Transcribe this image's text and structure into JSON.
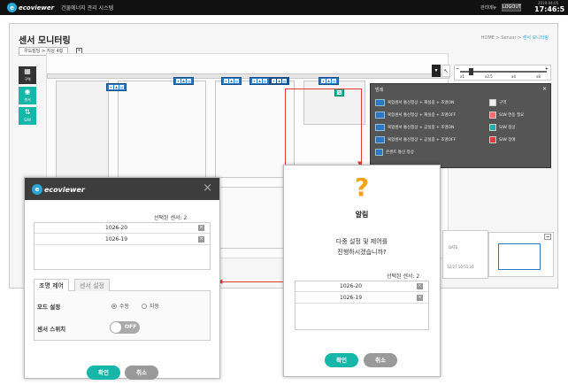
{
  "topbar": {
    "logo_mark": "e",
    "logo_text": "ecoviewer",
    "system_name": "건물에너지 관리 시스템",
    "manage_label": "관리메뉴",
    "logout_label": "LOGOUT",
    "date": "2019-04-05",
    "time": "17:46:5"
  },
  "page": {
    "title": "센서 모니터링",
    "breadcrumb_home": "HOME > Sensor > ",
    "breadcrumb_current": "센서 모니터링",
    "location_tab": "우도빌딩 > 지상 4층",
    "location_icon": "+"
  },
  "side": {
    "zone_icon": "▦",
    "zone_label": "구역",
    "sensor_icon": "◉",
    "sensor_label": "센서",
    "sw_icon": "⇅",
    "sw_label": "S/W"
  },
  "tools": {
    "arrow": "▾",
    "pointer": "↖",
    "zoom_out": "−",
    "zoom_in": "+",
    "zoom_levels": [
      "x1",
      "x2.5",
      "x4",
      "x8"
    ]
  },
  "legend": {
    "title": "범례",
    "close": "×",
    "rows": [
      "복합센서 통신정상 + 재실중 + 조명ON",
      "복합센서 통신정상 + 재실중 + 조명OFF",
      "복합센서 통신정상 + 공실중 + 조명ON",
      "복합센서 통신정상 + 공실중 + 조명OFF",
      "콘센트 통신 정상"
    ],
    "right": [
      {
        "label": "구역",
        "color": "#eeeeee"
      },
      {
        "label": "S/W 연동 필요",
        "color": "#ff6a6a"
      },
      {
        "label": "S/W 정상",
        "color": "#16b6a9"
      },
      {
        "label": "S/W 장애",
        "color": "#e03b3b"
      }
    ]
  },
  "mini_panel": {
    "label": "DATE",
    "stamp": "12/27 10:51:31",
    "toggle": "−"
  },
  "dialog_control": {
    "logo_mark": "e",
    "logo_text": "ecoviewer",
    "close": "×",
    "selected_label": "선택된 센서: 2",
    "rows": [
      "1026-20",
      "1026-19"
    ],
    "row_remove": "×",
    "tab_active": "조명 제어",
    "tab_inactive": "센서 설정",
    "mode_label": "모드 설정",
    "mode_manual": "수동",
    "mode_auto": "자동",
    "switch_label": "센서 스위치",
    "switch_state": "OFF",
    "ok": "확인",
    "cancel": "취소"
  },
  "dialog_alert": {
    "icon": "?",
    "title": "알림",
    "message_line1": "다중 설정 및 제어를",
    "message_line2": "진행하시겠습니까?",
    "selected_label": "선택된 센서: 2",
    "rows": [
      "1026-20",
      "1026-19"
    ],
    "row_remove": "×",
    "ok": "확인",
    "cancel": "취소"
  }
}
